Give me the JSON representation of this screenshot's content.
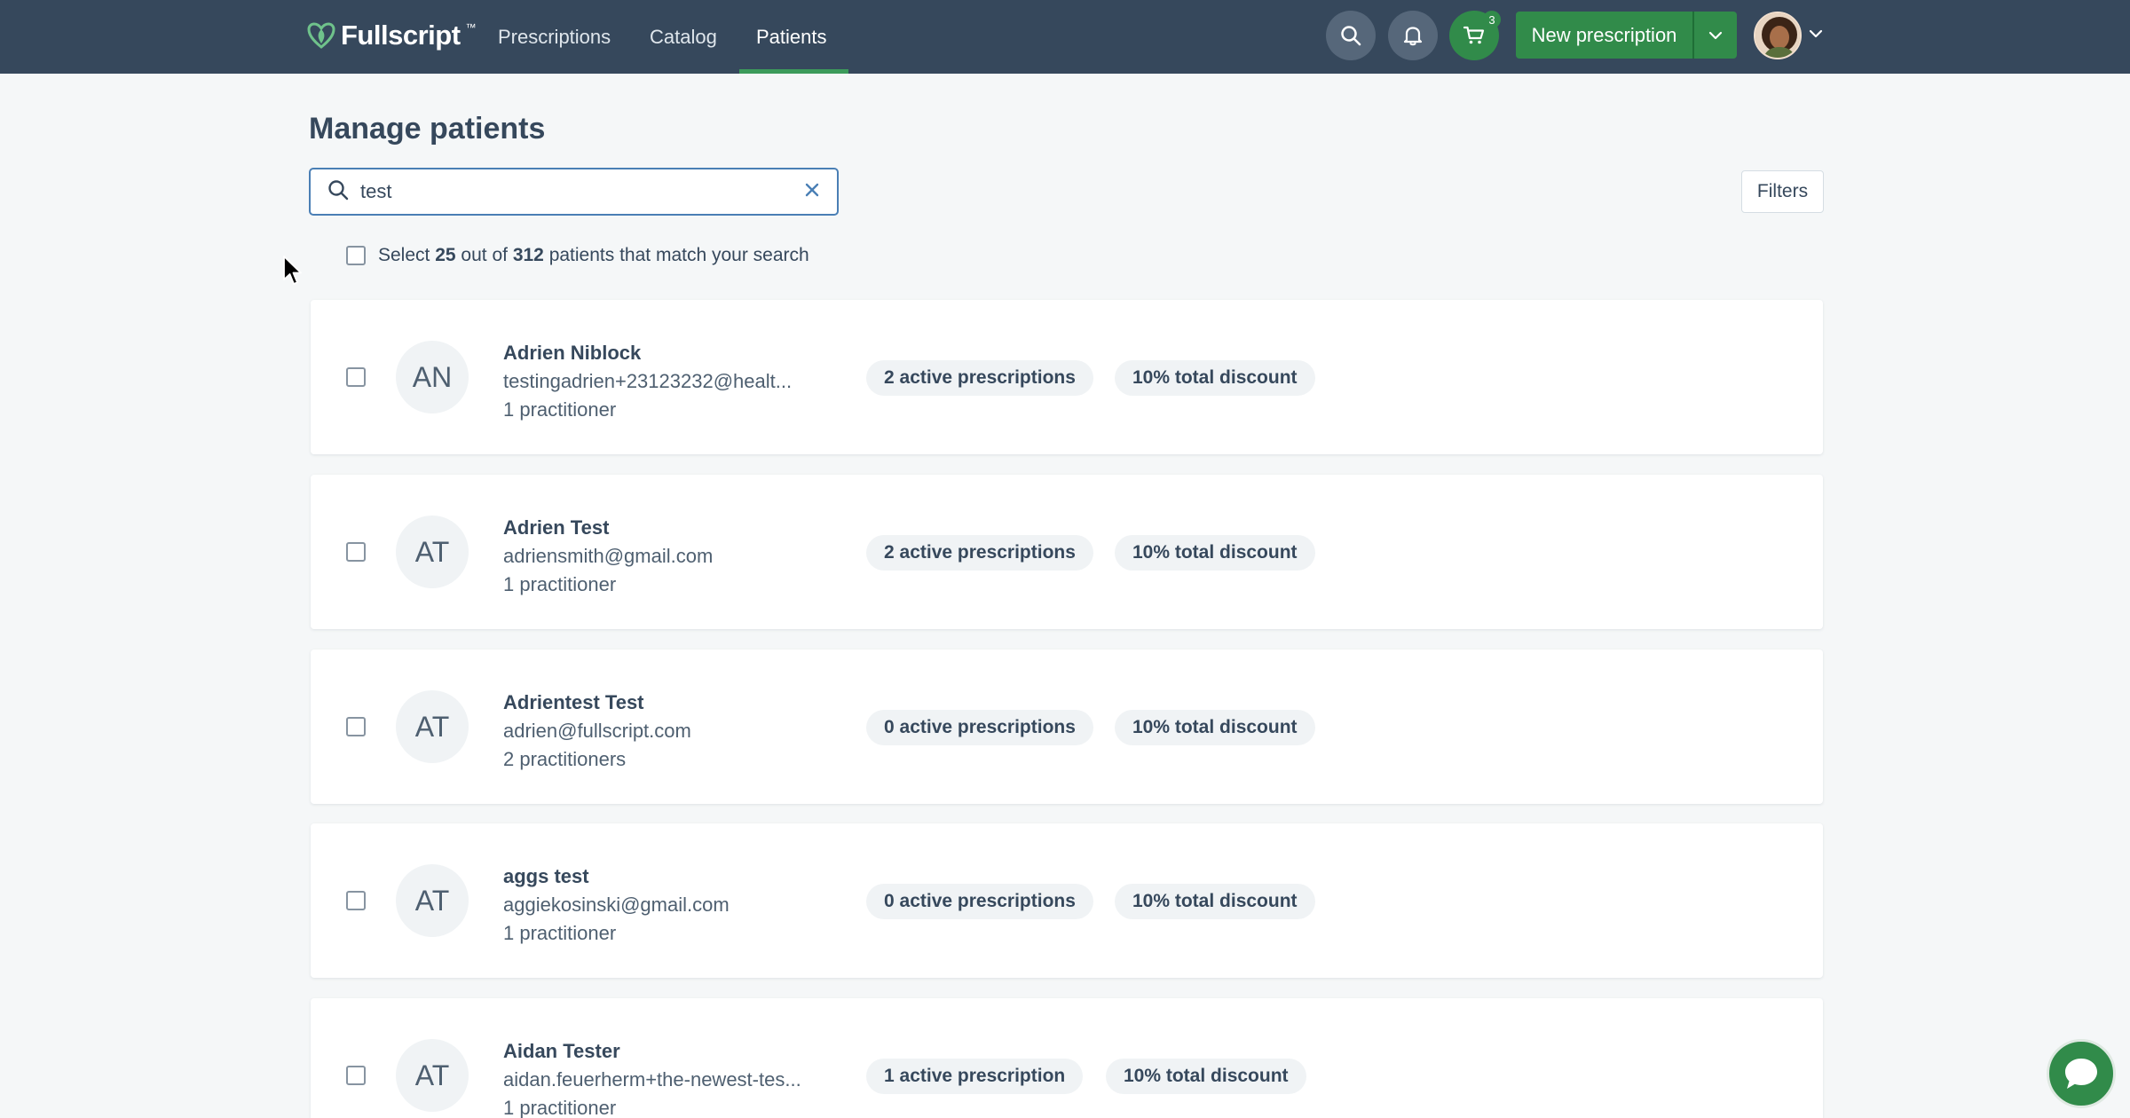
{
  "header": {
    "brand": "Fullscript",
    "brand_tm": "™",
    "nav": [
      {
        "label": "Prescriptions",
        "active": false
      },
      {
        "label": "Catalog",
        "active": false
      },
      {
        "label": "Patients",
        "active": true
      }
    ],
    "icons": {
      "search": "search-icon",
      "notifications": "bell-icon",
      "cart": "cart-icon"
    },
    "cart_count": "3",
    "new_prescription_label": "New prescription",
    "colors": {
      "bar": "#36485c",
      "accent": "#318b4a"
    }
  },
  "page": {
    "title": "Manage patients",
    "search_value": "test",
    "filters_label": "Filters",
    "select": {
      "prefix": "Select",
      "selected": "25",
      "middle": "out of",
      "total": "312",
      "suffix": "patients that match your search"
    }
  },
  "patients": [
    {
      "initials": "AN",
      "name": "Adrien Niblock",
      "email": "testingadrien+23123232@healt...",
      "practitioners": "1 practitioner",
      "prescriptions": "2 active prescriptions",
      "discount": "10% total discount"
    },
    {
      "initials": "AT",
      "name": "Adrien Test",
      "email": "adriensmith@gmail.com",
      "practitioners": "1 practitioner",
      "prescriptions": "2 active prescriptions",
      "discount": "10% total discount"
    },
    {
      "initials": "AT",
      "name": "Adrientest Test",
      "email": "adrien@fullscript.com",
      "practitioners": "2 practitioners",
      "prescriptions": "0 active prescriptions",
      "discount": "10% total discount"
    },
    {
      "initials": "AT",
      "name": "aggs test",
      "email": "aggiekosinski@gmail.com",
      "practitioners": "1 practitioner",
      "prescriptions": "0 active prescriptions",
      "discount": "10% total discount"
    },
    {
      "initials": "AT",
      "name": "Aidan Tester",
      "email": "aidan.feuerherm+the-newest-tes...",
      "practitioners": "1 practitioner",
      "prescriptions": "1 active prescription",
      "discount": "10% total discount"
    }
  ]
}
